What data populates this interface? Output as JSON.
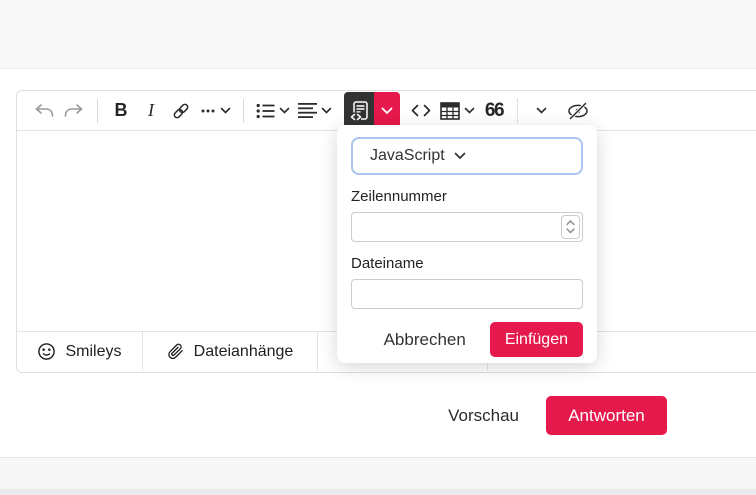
{
  "colors": {
    "accent_red": "#e5194c",
    "toolbar_active_bg": "#333333",
    "select_focus_ring": "#abc4f0",
    "band_gray": "#f8f8f8"
  },
  "toolbar": {
    "bold_label": "B",
    "italic_label": "I",
    "quote_label": "66"
  },
  "popup": {
    "language_select": {
      "value": "JavaScript"
    },
    "line_number_label": "Zeilennummer",
    "line_number_value": "",
    "filename_label": "Dateiname",
    "filename_value": "",
    "cancel_label": "Abbrechen",
    "insert_label": "Einfügen"
  },
  "tabs": [
    {
      "label": "Smileys"
    },
    {
      "label": "Dateianhänge"
    }
  ],
  "actions": {
    "preview_label": "Vorschau",
    "reply_label": "Antworten"
  }
}
